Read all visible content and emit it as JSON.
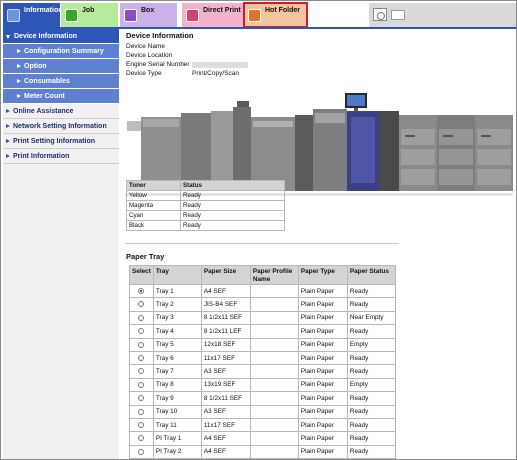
{
  "tabs": [
    {
      "label": "Information",
      "icon": "information-icon"
    },
    {
      "label": "Job",
      "icon": "job-icon"
    },
    {
      "label": "Box",
      "icon": "box-icon"
    },
    {
      "label": "Direct Print",
      "icon": "direct-print-icon"
    },
    {
      "label": "Hot Folder",
      "icon": "hot-folder-icon"
    }
  ],
  "sidebar": {
    "items": [
      {
        "label": "Device Information"
      },
      {
        "label": "Configuration Summary"
      },
      {
        "label": "Option"
      },
      {
        "label": "Consumables"
      },
      {
        "label": "Meter Count"
      },
      {
        "label": "Online Assistance"
      },
      {
        "label": "Network Setting Information"
      },
      {
        "label": "Print Setting Information"
      },
      {
        "label": "Print Information"
      }
    ]
  },
  "device": {
    "title": "Device Information",
    "rows": [
      {
        "label": "Device Name",
        "value": ""
      },
      {
        "label": "Device Location",
        "value": ""
      },
      {
        "label": "Engine Serial Number",
        "value": ""
      },
      {
        "label": "Device Type",
        "value": "Print/Copy/Scan"
      }
    ]
  },
  "toner": {
    "headers": [
      "Toner",
      "Status"
    ],
    "rows": [
      [
        "Yellow",
        "Ready"
      ],
      [
        "Magenta",
        "Ready"
      ],
      [
        "Cyan",
        "Ready"
      ],
      [
        "Black",
        "Ready"
      ]
    ]
  },
  "paper_tray": {
    "title": "Paper Tray",
    "headers": [
      "Select",
      "Tray",
      "Paper Size",
      "Paper Profile Name",
      "Paper Type",
      "Paper Status"
    ],
    "rows": [
      {
        "tray": "Tray 1",
        "size": "A4 SEF",
        "profile": "",
        "type": "Plain Paper",
        "status": "Ready",
        "selected": true
      },
      {
        "tray": "Tray 2",
        "size": "JIS-B4 SEF",
        "profile": "",
        "type": "Plain Paper",
        "status": "Ready",
        "selected": false
      },
      {
        "tray": "Tray 3",
        "size": "8 1/2x11 SEF",
        "profile": "",
        "type": "Plain Paper",
        "status": "Near Empty",
        "selected": false
      },
      {
        "tray": "Tray 4",
        "size": "8 1/2x11 LEF",
        "profile": "",
        "type": "Plain Paper",
        "status": "Ready",
        "selected": false
      },
      {
        "tray": "Tray 5",
        "size": "12x18 SEF",
        "profile": "",
        "type": "Plain Paper",
        "status": "Empty",
        "selected": false
      },
      {
        "tray": "Tray 6",
        "size": "11x17 SEF",
        "profile": "",
        "type": "Plain Paper",
        "status": "Ready",
        "selected": false
      },
      {
        "tray": "Tray 7",
        "size": "A3 SEF",
        "profile": "",
        "type": "Plain Paper",
        "status": "Ready",
        "selected": false
      },
      {
        "tray": "Tray 8",
        "size": "13x19 SEF",
        "profile": "",
        "type": "Plain Paper",
        "status": "Empty",
        "selected": false
      },
      {
        "tray": "Tray 9",
        "size": "8 1/2x11 SEF",
        "profile": "",
        "type": "Plain Paper",
        "status": "Ready",
        "selected": false
      },
      {
        "tray": "Tray 10",
        "size": "A3 SEF",
        "profile": "",
        "type": "Plain Paper",
        "status": "Ready",
        "selected": false
      },
      {
        "tray": "Tray 11",
        "size": "11x17 SEF",
        "profile": "",
        "type": "Plain Paper",
        "status": "Ready",
        "selected": false
      },
      {
        "tray": "PI Tray 1",
        "size": "A4 SEF",
        "profile": "",
        "type": "Plain Paper",
        "status": "Ready",
        "selected": false
      },
      {
        "tray": "PI Tray 2",
        "size": "A4 SEF",
        "profile": "",
        "type": "Plain Paper",
        "status": "Ready",
        "selected": false
      }
    ]
  },
  "colors": {
    "accent": "#2c57b7",
    "highlight_outline": "#d41a27",
    "sidebar_sub": "#5f7fd0"
  }
}
